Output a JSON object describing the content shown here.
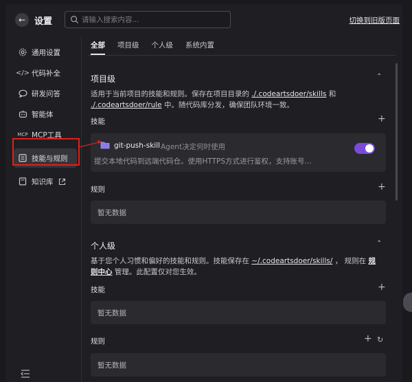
{
  "header": {
    "back_icon": "arrow-left-icon",
    "title": "设置",
    "search_placeholder": "请输入搜索内容...",
    "search_value": "",
    "switch_old_label": "切换到旧版页面"
  },
  "sidebar": {
    "items": [
      {
        "label": "通用设置",
        "icon": "gear-icon"
      },
      {
        "label": "代码补全",
        "icon": "code-icon"
      },
      {
        "label": "研发问答",
        "icon": "chat-icon"
      },
      {
        "label": "智能体",
        "icon": "agent-icon"
      },
      {
        "label": "MCP工具",
        "icon": "mcp-icon"
      },
      {
        "label": "技能与规则",
        "icon": "skills-icon",
        "active": true
      },
      {
        "label": "知识库",
        "icon": "book-icon",
        "external_icon": "external-link-icon"
      }
    ],
    "collapse_icon": "sidebar-collapse-icon"
  },
  "tabs": [
    "全部",
    "项目级",
    "个人级",
    "系统内置"
  ],
  "active_tab": "全部",
  "project": {
    "title": "项目级",
    "desc_pre": "适用于当前项目的技能和规则。保存在项目目录的",
    "link1": "./.codeartsdoer/skills",
    "desc_mid": "和",
    "link2": "./.codeartsdoer/rule",
    "desc_post": "中。随代码库分发，确保团队环境一致。",
    "skills_label": "技能",
    "skill": {
      "name": "git-push-skill",
      "hint": "Agent决定何时使用",
      "desc": "提交本地代码到远端代码仓。使用HTTPS方式进行鉴权，支持账号...",
      "enabled": true
    },
    "rules_label": "规则",
    "rules_empty": "暂无数据"
  },
  "personal": {
    "title": "个人级",
    "desc_pre": "基于您个人习惯和偏好的技能和规则。技能保存在",
    "link1": "~/.codeartsdoer/skills/",
    "desc_mid": "，  规则在",
    "link2": "规则中心",
    "desc_post": "管理。此配置仅对您生效。",
    "skills_label": "技能",
    "skills_empty": "暂无数据",
    "rules_label": "规则",
    "rules_empty": "暂无数据"
  },
  "colors": {
    "accent": "#7a4bd8",
    "highlight": "#e0201a"
  }
}
